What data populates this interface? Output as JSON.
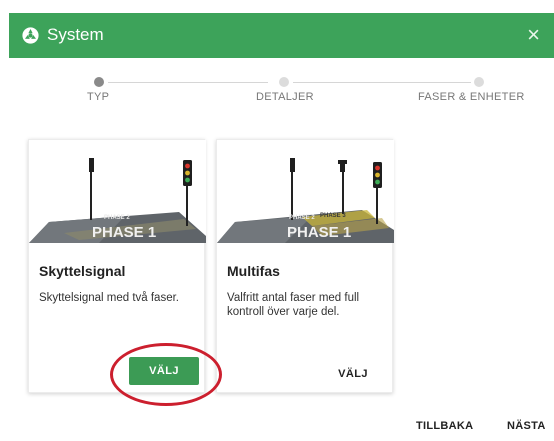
{
  "dialog": {
    "title": "System",
    "icon": "settings-gear-icon",
    "close_label": "×",
    "accent_color": "#3da35a"
  },
  "stepper": {
    "steps": [
      {
        "label": "TYP",
        "active": true
      },
      {
        "label": "DETALJER",
        "active": false
      },
      {
        "label": "FASER & ENHETER",
        "active": false
      }
    ]
  },
  "cards": [
    {
      "title": "Skyttelsignal",
      "description": "Skyttelsignal med två faser.",
      "button_label": "VÄLJ",
      "image_labels": [
        "PHASE 2",
        "PHASE 1"
      ]
    },
    {
      "title": "Multifas",
      "description": "Valfritt antal faser med full kontroll över varje del.",
      "button_label": "VÄLJ",
      "image_labels": [
        "PHASE 2",
        "PHASE 3",
        "PHASE 1"
      ]
    }
  ],
  "footer": {
    "back_label": "TILLBAKA",
    "next_label": "NÄSTA"
  }
}
